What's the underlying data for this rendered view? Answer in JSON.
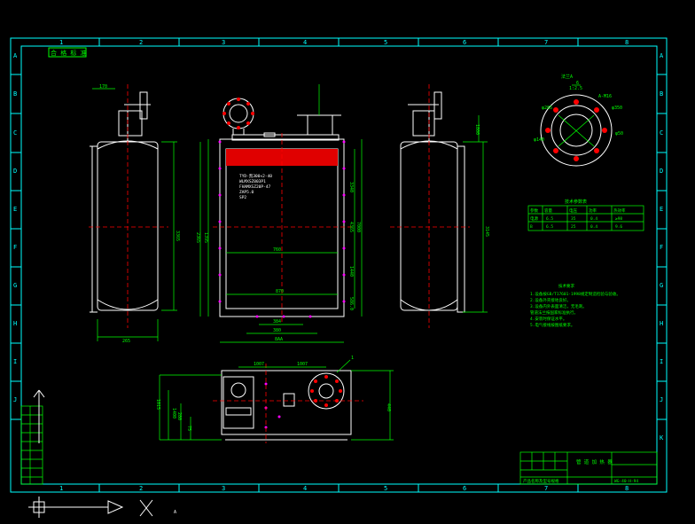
{
  "frame": {
    "col_labels": [
      "1",
      "2",
      "3",
      "4",
      "5",
      "6",
      "7",
      "8"
    ],
    "row_labels": [
      "A",
      "B",
      "C",
      "D",
      "E",
      "F",
      "G",
      "H",
      "I",
      "J",
      "K"
    ],
    "stamp_label": "合 格 标 准"
  },
  "front_view": {
    "nameplate_lines": [
      "TYD-凯300×2-40",
      "WLMXSZ003P1",
      "FHAMXSZ20P-47",
      "ZAP5.0",
      "SP2"
    ],
    "dims": {
      "inner_w": "760",
      "mid_w": "870",
      "bottom_w_a": "384",
      "bottom_w_b": "380",
      "total_w": "8AA",
      "h_left_a": "2365",
      "h_left_b": "1395",
      "h_right_a": "3340",
      "h_right_b": "4365",
      "h_right_c": "7000",
      "h_right_d": "1440",
      "h_right_e": "586.0"
    }
  },
  "left_view": {
    "dims": {
      "top": "170",
      "height": "3365",
      "width": "265"
    }
  },
  "right_view": {
    "dims": {
      "top": "1800",
      "height": "3145"
    }
  },
  "flange_detail": {
    "title": "法兰A",
    "labels": [
      "6",
      "1:2.5",
      "A-M16",
      "φ285",
      "φ350",
      "φ140",
      "φ50"
    ]
  },
  "table": {
    "title": "技术参数表",
    "headers": [
      "参数",
      "容量",
      "电压",
      "功率",
      "热效率"
    ],
    "rows": [
      [
        "电源",
        "6.5",
        "35",
        "0.4",
        "≥98"
      ],
      [
        "B",
        "6.5",
        "25",
        "0.4",
        "9.6"
      ]
    ]
  },
  "notes": {
    "title": "技术要求",
    "lines": [
      "1.设备按GB/T17601-1998规定制造检验与验收。",
      "2.设备外壳接地良好。",
      "3.设备内外表面清洁，无毛刺。",
      "  管道法兰按国家标准执行。",
      "4.安装时保证水平。",
      "5.电气接线按图纸要求。"
    ]
  },
  "plan_view": {
    "dims": {
      "a": "1007",
      "b": "1007",
      "c": "1015",
      "d": "1400",
      "e": "440",
      "f": "75",
      "g": "280"
    },
    "callout": "1"
  },
  "title_block": {
    "title": "管 道 加 热 器",
    "subtitle": "产品名称及型号规格",
    "drawing_no": "WG-40-H-94"
  },
  "ucs": {
    "label": "A"
  }
}
